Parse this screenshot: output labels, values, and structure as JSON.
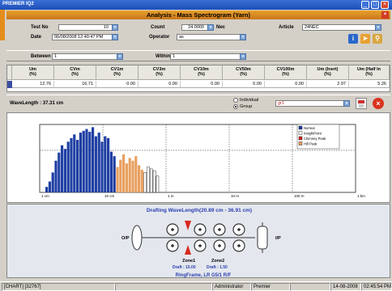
{
  "window": {
    "title": "PREMIER IQ2"
  },
  "dialog": {
    "title": "Analysis - Mass Spectrogram (Yarn)"
  },
  "form": {
    "test_no_label": "Test No",
    "test_no": "10",
    "count_label": "Count",
    "count": "24.0000",
    "count_unit": "Nec",
    "article_label": "Article",
    "article": "24NEC",
    "date_label": "Date",
    "date": "06/08/2008 12:40:47 PM",
    "operator_label": "Operator",
    "operator": "as"
  },
  "filters": {
    "between_label": "Between",
    "between": "1",
    "within_label": "Within",
    "within": "1"
  },
  "table": {
    "headers": [
      [
        "Um",
        "(%)"
      ],
      [
        "CVm",
        "(%)"
      ],
      [
        "CV1m",
        "(%)"
      ],
      [
        "CV3m",
        "(%)"
      ],
      [
        "CV10m",
        "(%)"
      ],
      [
        "CV50m",
        "(%)"
      ],
      [
        "CV100m",
        "(%)"
      ],
      [
        "Um (Inert)",
        "(%)"
      ],
      [
        "Um (Half In",
        "(%)"
      ]
    ],
    "row": [
      "12.76",
      "16.71",
      "0.00",
      "0.00",
      "0.00",
      "0.00",
      "0.00",
      "2.97",
      "5.26"
    ]
  },
  "wavelength": {
    "label": "WaveLength : 37.31 cm",
    "individual": "Individual",
    "group": "Group",
    "group_value": "gr1"
  },
  "chart_data": {
    "type": "bar",
    "x_labels": [
      "1 cm",
      "10 cm",
      "1 m",
      "10 m",
      "100 m",
      "1 km"
    ],
    "legend": [
      "Normal",
      "InsightPoint",
      "Chimney Peak",
      "Hill Peak"
    ],
    "legend_colors": [
      "#1f3fa3",
      "#ffffff",
      "#d8281e",
      "#e8a060"
    ],
    "series": [
      {
        "name": "Normal",
        "color": "#1f3fa3",
        "values": [
          6,
          12,
          22,
          35,
          44,
          52,
          48,
          56,
          60,
          64,
          58,
          66,
          68,
          70,
          67,
          72,
          62,
          66,
          56,
          62,
          60,
          45,
          40
        ]
      },
      {
        "name": "Hill Peak",
        "color": "#e8a060",
        "values": [
          28,
          36,
          42,
          32,
          38,
          35,
          40,
          30,
          25
        ]
      },
      {
        "name": "InsightPoint",
        "color": "#ffffff",
        "values": [
          22,
          28,
          26,
          24,
          18
        ]
      }
    ]
  },
  "drafting": {
    "title": "Drafting WaveLength(20.89 cm - 36.91 cm)",
    "op_label": "O/P",
    "ip_label": "I/P",
    "zone1": "Zone1",
    "zone2": "Zone2",
    "draft1": "Draft : 15.00",
    "draft2": "Draft : 1.50",
    "frame": "RingFrame, LR G5/1 R/F"
  },
  "status": {
    "chart": "[CHART] [32767]",
    "user": "Administrator",
    "app": "Premier",
    "date": "14-08-2008",
    "time": "02:45:54 PM"
  },
  "colors": {
    "accent": "#e58d1c",
    "title_blue": "#1d4fb8",
    "draft_blue": "#2b3fb0"
  }
}
